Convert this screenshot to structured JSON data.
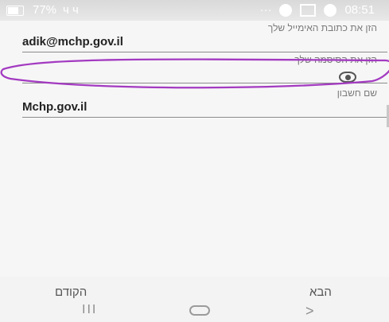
{
  "status": {
    "battery": "77%",
    "time": "08:51",
    "left_icons": "ч ч",
    "right_icons": "···"
  },
  "form": {
    "email": {
      "label": "הזן את כתובת האימייל שלך",
      "value": "adik@mchp.gov.il"
    },
    "password": {
      "label": "הזן את הסיסמה שלך",
      "value": ""
    },
    "account": {
      "label": "שם חשבון",
      "value": "Mchp.gov.il"
    }
  },
  "nav": {
    "previous": "הקודם",
    "next": "הבא"
  },
  "system": {
    "menu": "III",
    "back": ">"
  },
  "colors": {
    "purple_annotation": "#a33ac1"
  }
}
